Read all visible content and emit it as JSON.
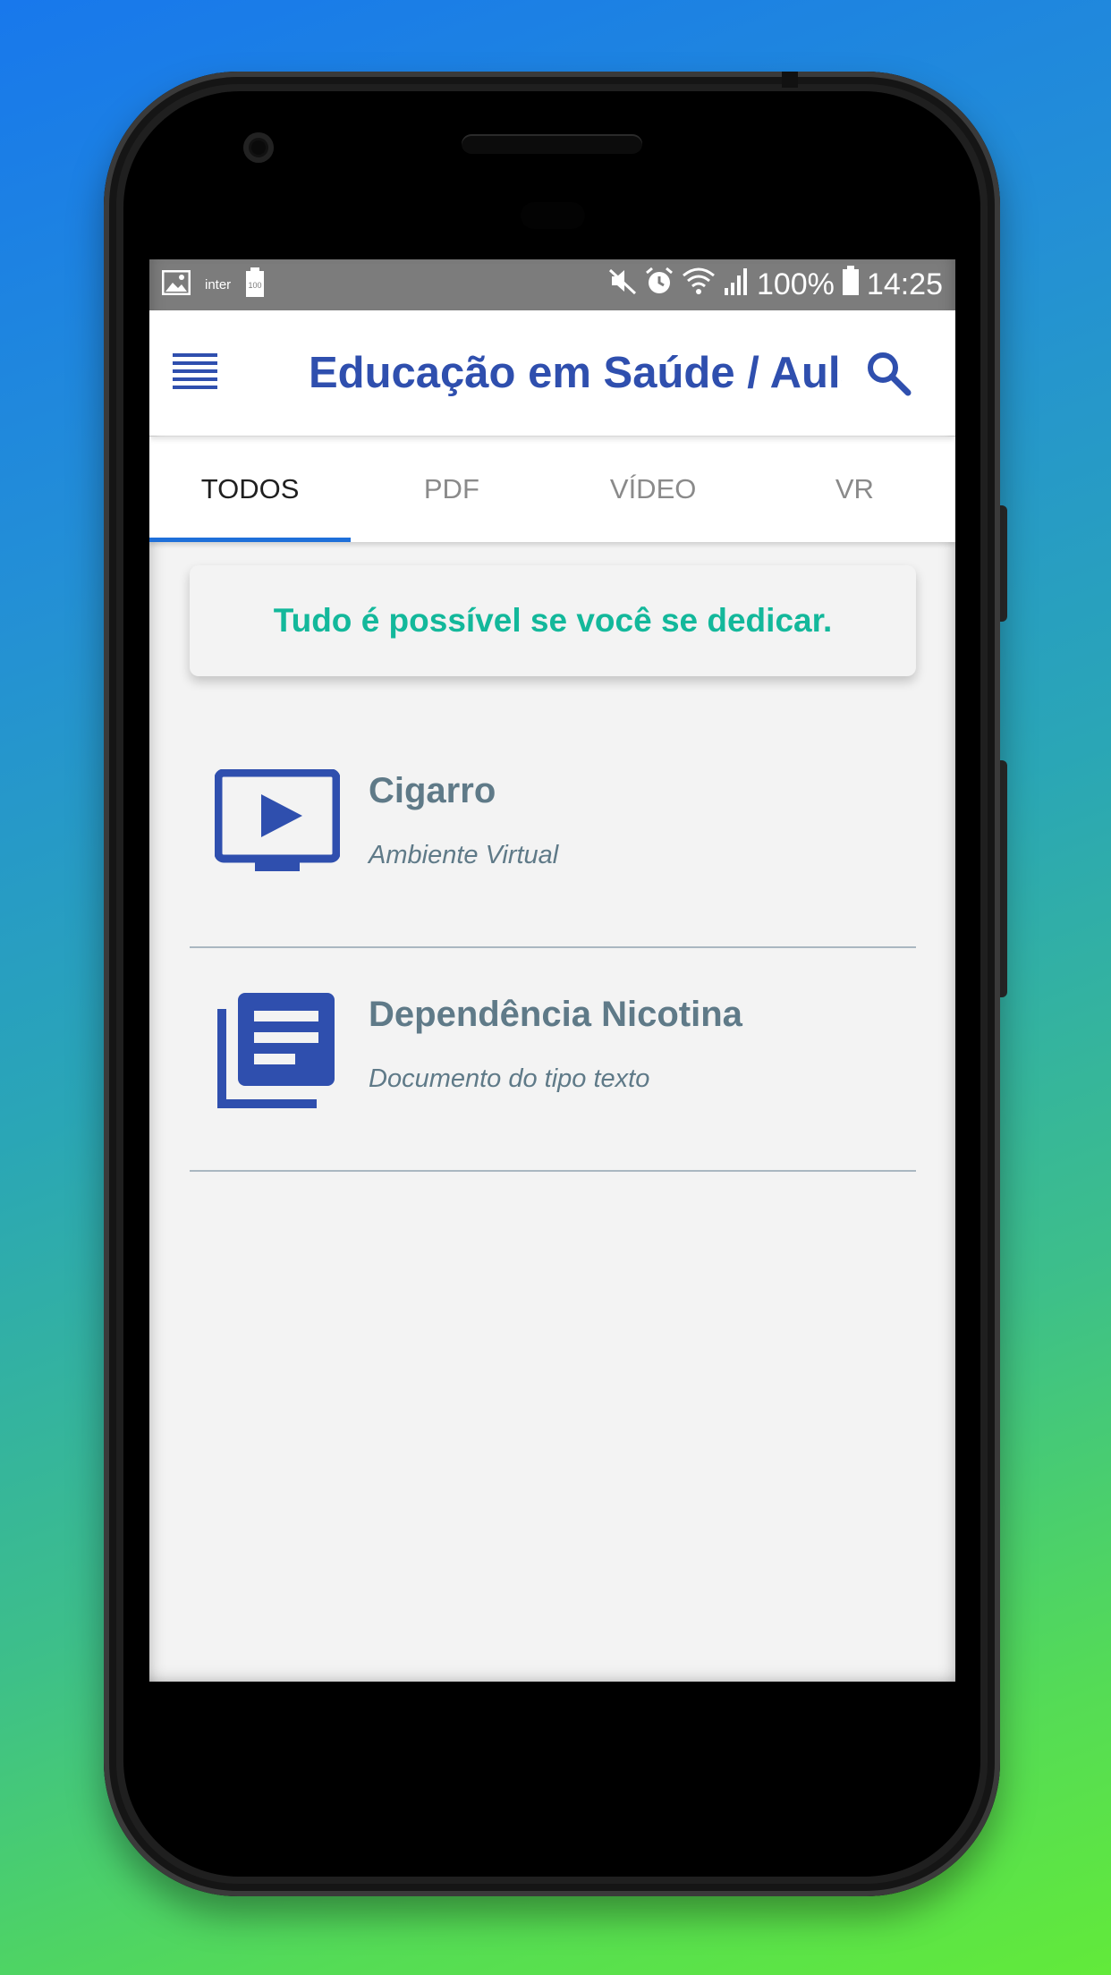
{
  "status_bar": {
    "carrier": "inter",
    "battery_small": "100",
    "battery_percent": "100%",
    "time": "14:25",
    "icons": [
      "image-icon",
      "battery-saver-icon",
      "mute-icon",
      "alarm-icon",
      "wifi-icon",
      "signal-icon",
      "battery-icon"
    ]
  },
  "appbar": {
    "title": "Educação em Saúde / Aula",
    "menu_icon": "menu-icon",
    "search_icon": "search-icon"
  },
  "tabs": [
    {
      "label": "TODOS",
      "active": true
    },
    {
      "label": "PDF",
      "active": false
    },
    {
      "label": "VÍDEO",
      "active": false
    },
    {
      "label": "VR",
      "active": false
    }
  ],
  "motto": "Tudo é possível se você se dedicar.",
  "items": [
    {
      "title": "Cigarro",
      "subtitle": "Ambiente Virtual",
      "icon": "video-screen-icon"
    },
    {
      "title": "Dependência Nicotina",
      "subtitle": "Documento do tipo texto",
      "icon": "document-library-icon"
    }
  ],
  "colors": {
    "accent": "#2f4fae",
    "motto": "#13b89b",
    "tab_indicator": "#1e6fd9",
    "item_text": "#5f7a88"
  }
}
